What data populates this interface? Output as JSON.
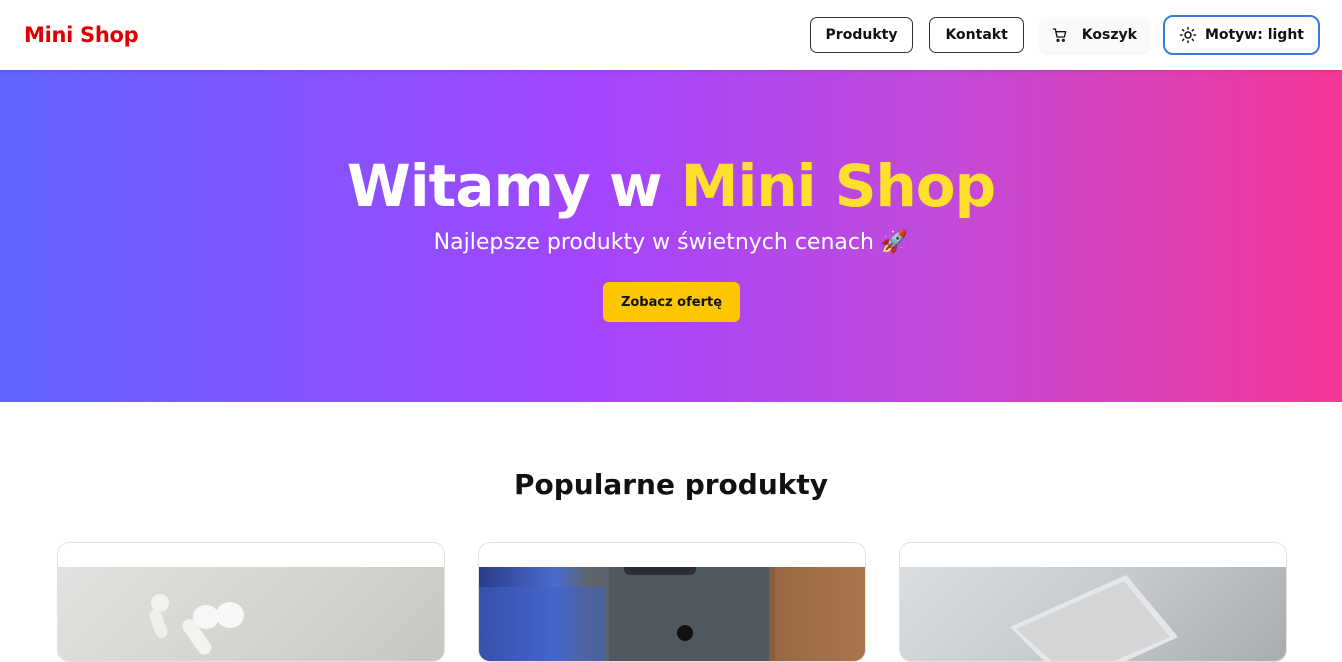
{
  "navbar": {
    "brand": "Mini Shop",
    "products_label": "Produkty",
    "contact_label": "Kontakt",
    "cart_label": "Koszyk",
    "theme_label": "Motyw: light",
    "cart_icon": "cart-icon",
    "theme_icon": "sun-icon"
  },
  "hero": {
    "title_prefix": "Witamy w ",
    "title_accent": "Mini Shop",
    "subtitle": "Najlepsze produkty w świetnych cenach 🚀",
    "cta_label": "Zobacz ofertę",
    "gradient_colors": [
      "#6163fc",
      "#a545fd",
      "#f43796"
    ],
    "accent_color": "#fde02b"
  },
  "popular": {
    "title": "Popularne produkty"
  },
  "colors": {
    "brand": "#e00000",
    "cta": "#fcc600",
    "focus_ring": "#3b7be0"
  }
}
